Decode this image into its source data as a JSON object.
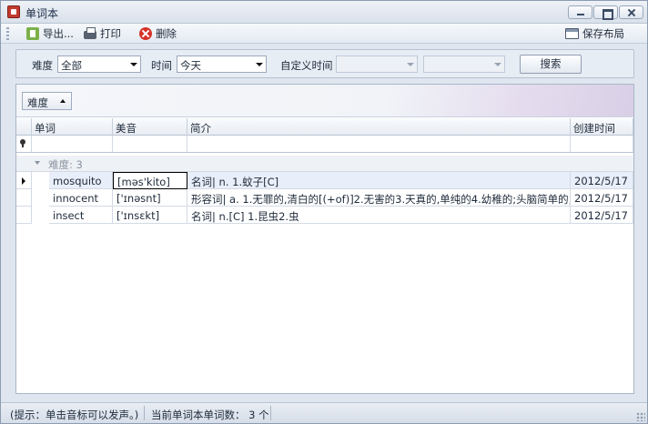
{
  "window": {
    "title": "单词本"
  },
  "toolbar": {
    "export_label": "导出...",
    "print_label": "打印",
    "delete_label": "删除",
    "save_layout_label": "保存布局"
  },
  "filter": {
    "difficulty_label": "难度",
    "difficulty_value": "全部",
    "time_label": "时间",
    "time_value": "今天",
    "custom_time_label": "自定义时间",
    "custom_start_value": "",
    "custom_end_value": "",
    "search_label": "搜索"
  },
  "grid": {
    "group_chip_label": "难度",
    "columns": {
      "word": "单词",
      "phonetic": "美音",
      "brief": "简介",
      "created": "创建时间"
    },
    "group_label": "难度: 3",
    "rows": [
      {
        "word": "mosquito",
        "phonetic": "[məs'kito]",
        "brief": "名词| n.  1.蚊子[C]",
        "created": "2012/5/17"
      },
      {
        "word": "innocent",
        "phonetic": "['ɪnəsnt]",
        "brief": "形容词| a.  1.无罪的,清白的[(+of)]2.无害的3.天真的,单纯的4.幼稚的;头脑简单的,...",
        "created": "2012/5/17"
      },
      {
        "word": "insect",
        "phonetic": "['ɪnsɛkt]",
        "brief": "名词| n.[C] 1.昆虫2.虫",
        "created": "2012/5/17"
      }
    ]
  },
  "status": {
    "hint": "(提示：单击音标可以发声。)",
    "count_text": "当前单词本单词数： 3 个"
  }
}
